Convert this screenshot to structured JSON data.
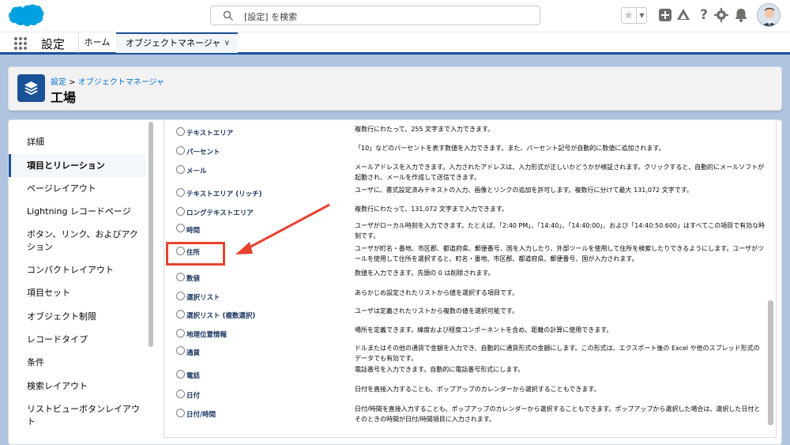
{
  "header": {
    "search_placeholder": "[設定] を検索",
    "icons": [
      "salesforce-cloud-logo",
      "star-icon",
      "add-icon",
      "trailhead-icon",
      "help-icon",
      "gear-icon",
      "bell-icon",
      "avatar"
    ]
  },
  "nav": {
    "app_name": "設定",
    "home_label": "ホーム",
    "active_tab_label": "オブジェクトマネージャ"
  },
  "page_header": {
    "breadcrumb_root": "設定",
    "breadcrumb_sep": " > ",
    "breadcrumb_current": "オブジェクトマネージャ",
    "title": "工場"
  },
  "sidebar": {
    "items": [
      {
        "label": "詳細"
      },
      {
        "label": "項目とリレーション"
      },
      {
        "label": "ページレイアウト"
      },
      {
        "label": "Lightning レコードページ"
      },
      {
        "label": "ボタン、リンク、およびアクション"
      },
      {
        "label": "コンパクトレイアウト"
      },
      {
        "label": "項目セット"
      },
      {
        "label": "オブジェクト制限"
      },
      {
        "label": "レコードタイプ"
      },
      {
        "label": "条件"
      },
      {
        "label": "検索レイアウト"
      },
      {
        "label": "リストビューボタンレイアウト"
      }
    ]
  },
  "field_types": [
    {
      "label": "テキストエリア",
      "desc": "複数行にわたって、255 文字まで入力できます。"
    },
    {
      "label": "パーセント",
      "desc": "「10」などのパーセントを表す数値を入力できます。また、パーセント記号が自動的に数値に追加されます。"
    },
    {
      "label": "メール",
      "desc": "メールアドレスを入力できます。入力されたアドレスは、入力形式が正しいかどうかが検証されます。クリックすると、自動的にメールソフトが起動され、メールを作成して送信できます。"
    },
    {
      "label": "テキストエリア (リッチ)",
      "desc": "ユーザに、書式設定済みテキストの入力、画像とリンクの追加を許可します。複数行に分けて最大 131,072 文字です。"
    },
    {
      "label": "ロングテキストエリア",
      "desc": "複数行にわたって、131,072 文字まで入力できます。"
    },
    {
      "label": "時間",
      "desc": "ユーザがローカル時刻を入力できます。たとえば、「2:40 PM」、「14:40」、「14:40:00」、および「14:40:50.600」はすべてこの項目で有効な時刻です。"
    },
    {
      "label": "住所",
      "desc": "ユーザが町名・番地、市区郡、都道府県、郵便番号、国を入力したり、外部ツールを使用して住所を検索したりできるようにします。ユーザがツールを使用して住所を選択すると、町名・番地、市区郡、都道府県、郵便番号、国が入力されます。"
    },
    {
      "label": "数値",
      "desc": "数値を入力できます。先頭の 0 は削除されます。"
    },
    {
      "label": "選択リスト",
      "desc": "あらかじめ設定されたリストから値を選択する項目です。"
    },
    {
      "label": "選択リスト (複数選択)",
      "desc": "ユーザは定義されたリストから複数の値を選択可能です。"
    },
    {
      "label": "地理位置情報",
      "desc": "場所を定義できます。緯度および経度コンポーネントを含め、距離の計算に使用できます。"
    },
    {
      "label": "通貨",
      "desc": "ドルまたはその他の通貨で金額を入力でき、自動的に通貨形式の金額にします。この形式は、エクスポート後の Excel や他のスプレッド形式のデータでも有効です。"
    },
    {
      "label": "電話",
      "desc": "電話番号を入力できます。自動的に電話番号形式にします。"
    },
    {
      "label": "日付",
      "desc": "日付を直接入力することも、ポップアップのカレンダーから選択することもできます。"
    },
    {
      "label": "日付/時間",
      "desc": "日付/時間を直接入力することも、ポップアップのカレンダーから選択することもできます。ポップアップから選択した場合は、選択した日付とそのときの時間が日付/時間項目に入力されます。"
    }
  ],
  "colors": {
    "brand_blue": "#1b5297",
    "link_blue": "#0070d2",
    "highlight_red": "#e8432e"
  }
}
